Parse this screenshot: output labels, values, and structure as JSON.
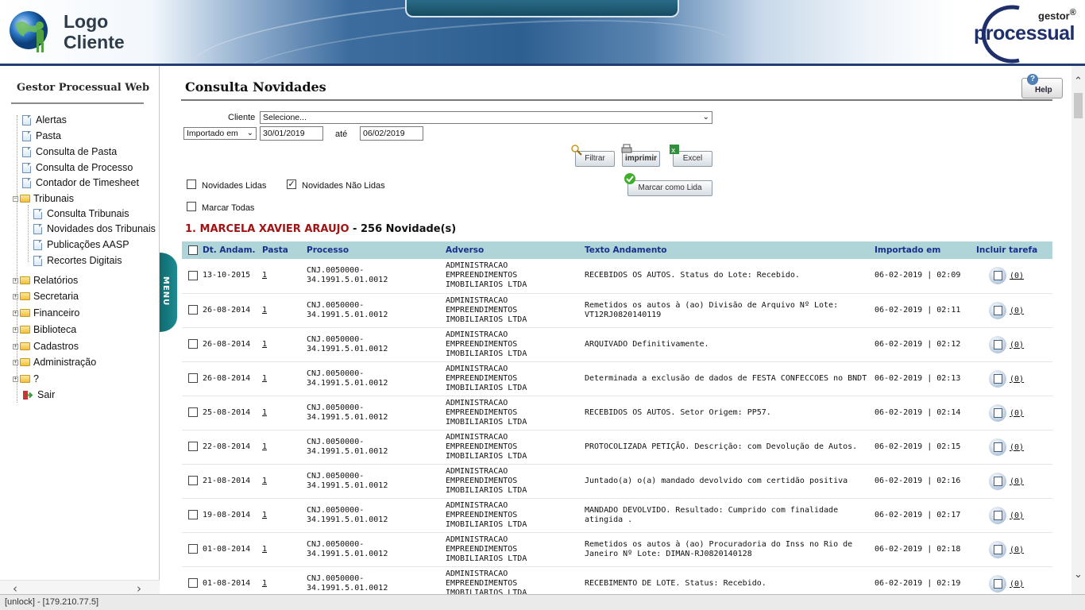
{
  "header": {
    "logo_line1": "Logo",
    "logo_line2": "Cliente",
    "brand_gestor": "gestor",
    "brand_reg": "®",
    "brand_name": "processual"
  },
  "sidebar": {
    "title": "Gestor Processual Web",
    "items": [
      {
        "label": "Alertas",
        "kind": "doc"
      },
      {
        "label": "Pasta",
        "kind": "doc"
      },
      {
        "label": "Consulta de Pasta",
        "kind": "doc"
      },
      {
        "label": "Consulta de Processo",
        "kind": "doc"
      },
      {
        "label": "Contador de Timesheet",
        "kind": "doc"
      },
      {
        "label": "Tribunais",
        "kind": "folder-open"
      },
      {
        "label": "Consulta Tribunais",
        "kind": "doc-child"
      },
      {
        "label": "Novidades dos Tribunais",
        "kind": "doc-child"
      },
      {
        "label": "Publicações AASP",
        "kind": "doc-child"
      },
      {
        "label": "Recortes Digitais",
        "kind": "doc-child"
      },
      {
        "label": "Relatórios",
        "kind": "folder"
      },
      {
        "label": "Secretaria",
        "kind": "folder"
      },
      {
        "label": "Financeiro",
        "kind": "folder"
      },
      {
        "label": "Biblioteca",
        "kind": "folder"
      },
      {
        "label": "Cadastros",
        "kind": "folder"
      },
      {
        "label": "Administração",
        "kind": "folder"
      },
      {
        "label": "?",
        "kind": "folder"
      },
      {
        "label": "Sair",
        "kind": "exit"
      }
    ],
    "menu_tab": "MENU"
  },
  "main": {
    "title": "Consulta Novidades",
    "help_label": "Help",
    "cliente_label": "Cliente",
    "cliente_value": "Selecione...",
    "date_filter_select": "Importado em",
    "date_from": "30/01/2019",
    "ate_label": "até",
    "date_to": "06/02/2019",
    "buttons": {
      "filtrar": "Filtrar",
      "imprimir": "imprimir",
      "excel": "Excel",
      "marcar_lida": "Marcar como Lida"
    },
    "checkboxes": {
      "lidas": {
        "label": "Novidades Lidas",
        "checked": false
      },
      "nao_lidas": {
        "label": "Novidades Não Lidas",
        "checked": true
      },
      "marcar_todas": {
        "label": "Marcar Todas",
        "checked": false
      }
    },
    "client_block": {
      "index": "1.",
      "name": "MARCELA XAVIER ARAUJO",
      "separator": "-",
      "count": "256 Novidade(s)"
    },
    "table": {
      "headers": [
        "Dt. Andam.",
        "Pasta",
        "Processo",
        "Adverso",
        "Texto Andamento",
        "Importado em",
        "Incluir tarefa"
      ],
      "rows": [
        {
          "date": "13-10-2015",
          "pasta": "1",
          "proc1": "CNJ.0050000-",
          "proc2": "34.1991.5.01.0012",
          "adv1": "ADMINISTRACAO",
          "adv2": "EMPREENDIMENTOS",
          "adv3": "IMOBILIARIOS LTDA",
          "texto": "RECEBIDOS OS AUTOS. Status do Lote: Recebido.",
          "importado": "06-02-2019 | 02:09",
          "tarefa": "(0)"
        },
        {
          "date": "26-08-2014",
          "pasta": "1",
          "proc1": "CNJ.0050000-",
          "proc2": "34.1991.5.01.0012",
          "adv1": "ADMINISTRACAO",
          "adv2": "EMPREENDIMENTOS",
          "adv3": "IMOBILIARIOS LTDA",
          "texto": "Remetidos os autos à (ao) Divisão de Arquivo Nº Lote: VT12RJ0820140119",
          "importado": "06-02-2019 | 02:11",
          "tarefa": "(0)"
        },
        {
          "date": "26-08-2014",
          "pasta": "1",
          "proc1": "CNJ.0050000-",
          "proc2": "34.1991.5.01.0012",
          "adv1": "ADMINISTRACAO",
          "adv2": "EMPREENDIMENTOS",
          "adv3": "IMOBILIARIOS LTDA",
          "texto": "ARQUIVADO Definitivamente.",
          "importado": "06-02-2019 | 02:12",
          "tarefa": "(0)"
        },
        {
          "date": "26-08-2014",
          "pasta": "1",
          "proc1": "CNJ.0050000-",
          "proc2": "34.1991.5.01.0012",
          "adv1": "ADMINISTRACAO",
          "adv2": "EMPREENDIMENTOS",
          "adv3": "IMOBILIARIOS LTDA",
          "texto": "Determinada a exclusão de dados de FESTA CONFECCOES no BNDT",
          "importado": "06-02-2019 | 02:13",
          "tarefa": "(0)"
        },
        {
          "date": "25-08-2014",
          "pasta": "1",
          "proc1": "CNJ.0050000-",
          "proc2": "34.1991.5.01.0012",
          "adv1": "ADMINISTRACAO",
          "adv2": "EMPREENDIMENTOS",
          "adv3": "IMOBILIARIOS LTDA",
          "texto": "RECEBIDOS OS AUTOS. Setor Origem: PP57.",
          "importado": "06-02-2019 | 02:14",
          "tarefa": "(0)"
        },
        {
          "date": "22-08-2014",
          "pasta": "1",
          "proc1": "CNJ.0050000-",
          "proc2": "34.1991.5.01.0012",
          "adv1": "ADMINISTRACAO",
          "adv2": "EMPREENDIMENTOS",
          "adv3": "IMOBILIARIOS LTDA",
          "texto": "PROTOCOLIZADA PETIÇÃO. Descrição: com Devolução de Autos.",
          "importado": "06-02-2019 | 02:15",
          "tarefa": "(0)"
        },
        {
          "date": "21-08-2014",
          "pasta": "1",
          "proc1": "CNJ.0050000-",
          "proc2": "34.1991.5.01.0012",
          "adv1": "ADMINISTRACAO",
          "adv2": "EMPREENDIMENTOS",
          "adv3": "IMOBILIARIOS LTDA",
          "texto": "Juntado(a) o(a) mandado devolvido com certidão positiva",
          "importado": "06-02-2019 | 02:16",
          "tarefa": "(0)"
        },
        {
          "date": "19-08-2014",
          "pasta": "1",
          "proc1": "CNJ.0050000-",
          "proc2": "34.1991.5.01.0012",
          "adv1": "ADMINISTRACAO",
          "adv2": "EMPREENDIMENTOS",
          "adv3": "IMOBILIARIOS LTDA",
          "texto": "MANDADO DEVOLVIDO. Resultado: Cumprido com finalidade atingida .",
          "importado": "06-02-2019 | 02:17",
          "tarefa": "(0)"
        },
        {
          "date": "01-08-2014",
          "pasta": "1",
          "proc1": "CNJ.0050000-",
          "proc2": "34.1991.5.01.0012",
          "adv1": "ADMINISTRACAO",
          "adv2": "EMPREENDIMENTOS",
          "adv3": "IMOBILIARIOS LTDA",
          "texto": "Remetidos os autos à (ao) Procuradoria do Inss no Rio de Janeiro Nº Lote: DIMAN-RJ0820140128",
          "importado": "06-02-2019 | 02:18",
          "tarefa": "(0)"
        },
        {
          "date": "01-08-2014",
          "pasta": "1",
          "proc1": "CNJ.0050000-",
          "proc2": "34.1991.5.01.0012",
          "adv1": "ADMINISTRACAO",
          "adv2": "EMPREENDIMENTOS",
          "adv3": "IMOBILIARIOS LTDA",
          "texto": "RECEBIMENTO DE LOTE. Status: Recebido.",
          "importado": "06-02-2019 | 02:19",
          "tarefa": "(0)"
        }
      ]
    }
  },
  "status_bar": "[unlock] - [179.210.77.5]",
  "colors": {
    "header_dark": "#203d74",
    "client_name": "#a11212",
    "table_header_bg": "#afd5d8",
    "table_header_text": "#1a2f8c",
    "menu_tab": "#0d6a6e"
  }
}
